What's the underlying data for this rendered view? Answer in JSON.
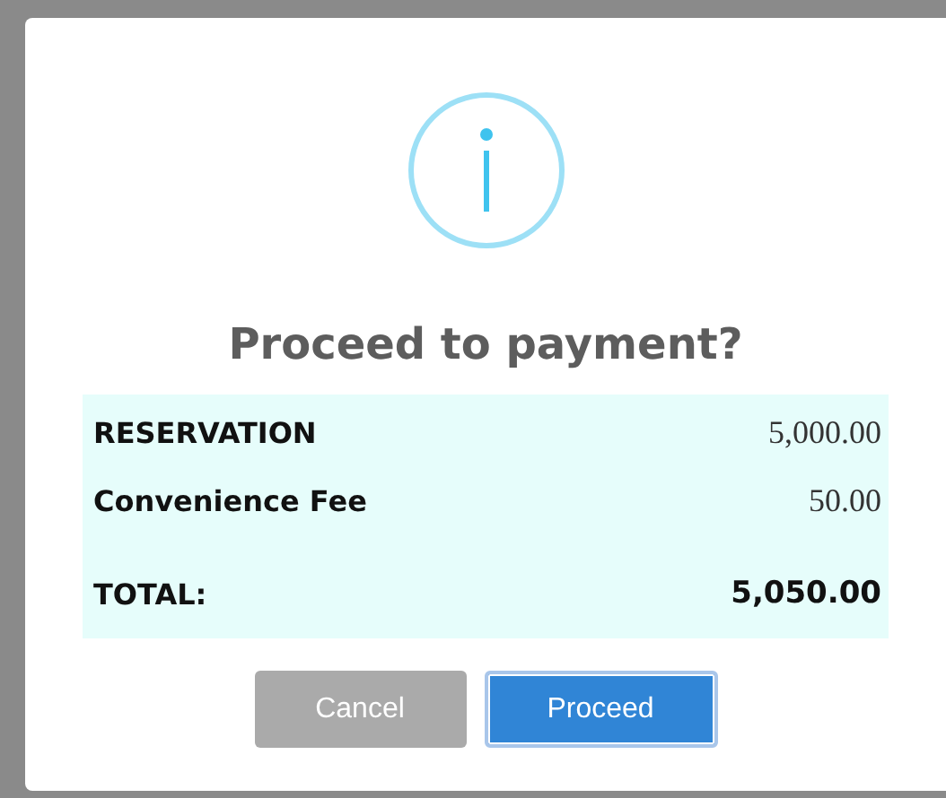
{
  "dialog": {
    "title": "Proceed to payment?",
    "rows": [
      {
        "kind": "item",
        "label": "RESERVATION",
        "amount": "5,000.00"
      },
      {
        "kind": "item",
        "label": "Convenience Fee",
        "amount": "50.00"
      },
      {
        "kind": "total",
        "label": "TOTAL:",
        "amount": "5,050.00"
      }
    ],
    "buttons": [
      {
        "kind": "cancel",
        "label": "Cancel",
        "focused": false
      },
      {
        "kind": "confirm",
        "label": "Proceed",
        "focused": true
      }
    ]
  }
}
